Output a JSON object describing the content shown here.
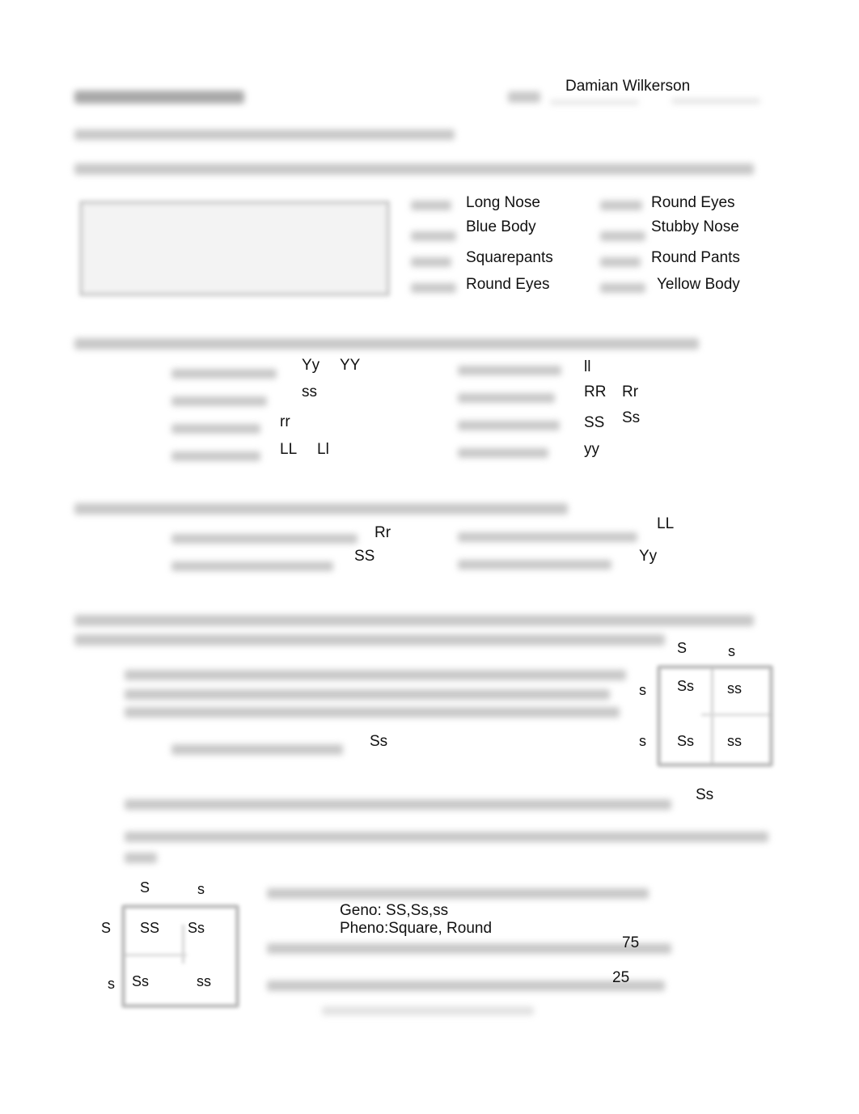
{
  "header": {
    "student_name": "Damian Wilkerson"
  },
  "section1": {
    "answers_left": [
      "Long Nose",
      "Blue Body",
      "Squarepants",
      "Round Eyes"
    ],
    "answers_right": [
      "Round Eyes",
      "Stubby Nose",
      "Round Pants",
      "Yellow Body"
    ]
  },
  "section2": {
    "left": [
      {
        "a": "Yy",
        "b": "YY"
      },
      {
        "a": "ss"
      },
      {
        "a": "rr"
      },
      {
        "a": "LL",
        "b": "Ll"
      }
    ],
    "right": [
      {
        "a": "ll"
      },
      {
        "a": "RR",
        "b": "Rr"
      },
      {
        "a": "SS",
        "b": "Ss"
      },
      {
        "a": "yy"
      }
    ]
  },
  "section3": {
    "left": [
      "Rr",
      "SS"
    ],
    "right": [
      "LL",
      "Yy"
    ]
  },
  "section4": {
    "a_answer": "Ss",
    "b_answer": "Ss",
    "punnett1": {
      "top": [
        "S",
        "s"
      ],
      "side": [
        "s",
        "s"
      ],
      "cells": [
        [
          "Ss",
          "ss"
        ],
        [
          "Ss",
          "ss"
        ]
      ]
    },
    "punnett2": {
      "top": [
        "S",
        "s"
      ],
      "side": [
        "S",
        "s"
      ],
      "cells": [
        [
          "SS",
          "Ss"
        ],
        [
          "Ss",
          "ss"
        ]
      ]
    },
    "geno": "Geno: SS,Ss,ss",
    "pheno": "Pheno:Square, Round",
    "percent_square": "75",
    "percent_round": "25"
  }
}
